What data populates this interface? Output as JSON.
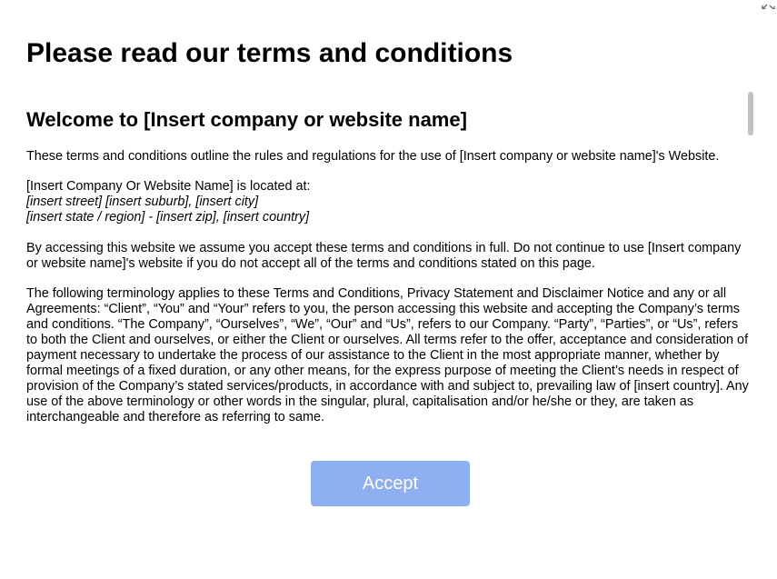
{
  "dialog": {
    "title": "Please read our terms and conditions",
    "expand_icon": "expand-arrows-icon",
    "accept_label": "Accept",
    "accept_color": "#8eaff0"
  },
  "terms": {
    "heading": "Welcome to [Insert company or website name]",
    "intro": "These terms and conditions outline the rules and regulations for the use of [Insert company or website name]'s Website.",
    "location_label": "[Insert Company Or Website Name] is located at:",
    "address_line_1": "[insert street] [insert suburb], [insert city]",
    "address_line_2": "[insert state / region] - [insert zip], [insert country]",
    "acceptance": "By accessing this website we assume you accept these terms and conditions in full. Do not continue to use [Insert company or website name]'s website if you do not accept all of the terms and conditions stated on this page.",
    "terminology": "The following terminology applies to these Terms and Conditions, Privacy Statement and Disclaimer Notice and any or all Agreements: “Client”, “You” and “Your” refers to you, the person accessing this website and accepting the Company’s terms and conditions. “The Company”, “Ourselves”, “We”, “Our” and “Us”, refers to our Company. “Party”, “Parties”, or “Us”, refers to both the Client and ourselves, or either the Client or ourselves. All terms refer to the offer, acceptance and consideration of payment necessary to undertake the process of our assistance to the Client in the most appropriate manner, whether by formal meetings of a fixed duration, or any other means, for the express purpose of meeting the Client’s needs in respect of provision of the Company’s stated services/products, in accordance with and subject to, prevailing law of [insert country]. Any use of the above terminology or other words in the singular, plural, capitalisation and/or he/she or they, are taken as interchangeable and therefore as referring to same."
  }
}
